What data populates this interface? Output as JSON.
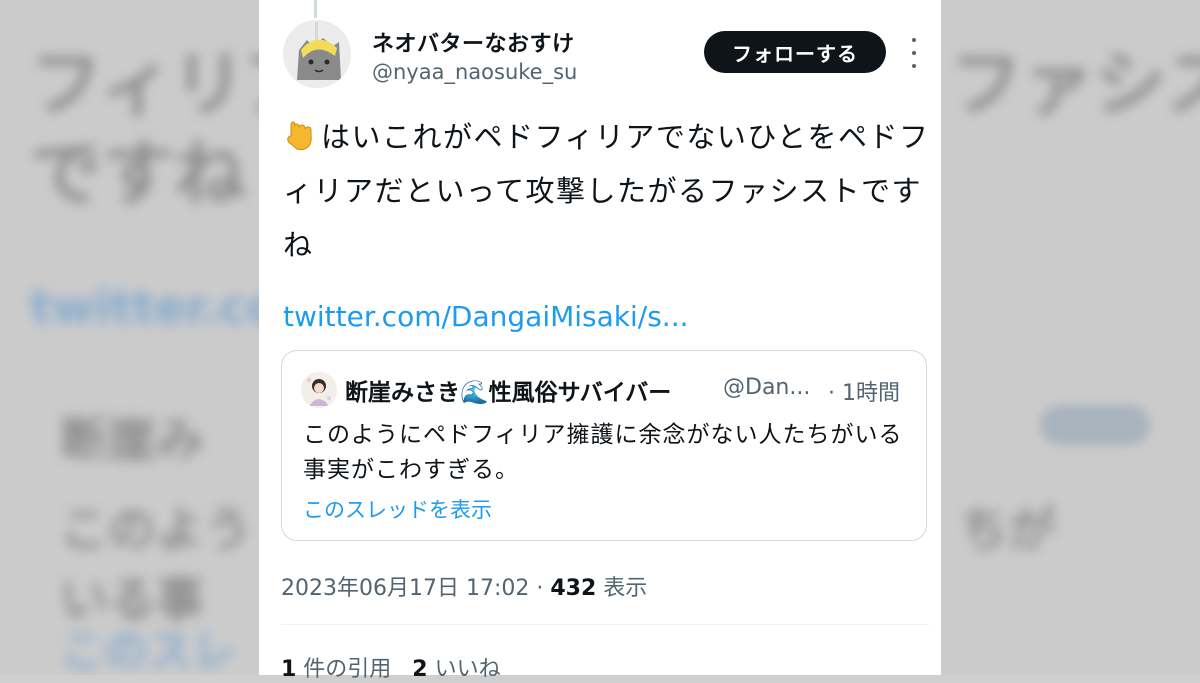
{
  "background": {
    "line1": "フィリア",
    "line2": "ですね",
    "link": "twitter.com",
    "quote_line1": "断崖み",
    "quote_line2": "このよう",
    "quote_line3": "いる事",
    "quote_line4": "このスレ",
    "right_line1": "ファシスト",
    "right_line2": "ちが"
  },
  "author": {
    "display_name": "ネオバターなおすけ",
    "handle": "@nyaa_naosuke_su",
    "avatar_icon": "cat-avatar-icon"
  },
  "follow_label": "フォローする",
  "tweet": {
    "emoji_icon": "pointing-down-finger-icon",
    "text": "はいこれがペドフィリアでないひとをペドフィリアだといって攻撃したがるファシストですね",
    "link_text": "twitter.com/DangaiMisaki/s..."
  },
  "quoted_tweet": {
    "display_name": "断崖みさき🌊性風俗サバイバー",
    "handle": "@Dan...",
    "time": "· 1時間",
    "text": "このようにペドフィリア擁護に余念がない人たちがいる事実がこわすぎる。",
    "thread_link": "このスレッドを表示"
  },
  "meta": {
    "timestamp": "2023年06月17日 17:02 · ",
    "views_count": "432",
    "views_label": " 表示"
  },
  "stats": {
    "quotes_count": "1",
    "quotes_label": " 件の引用",
    "likes_count": "2",
    "likes_label": " いいね"
  },
  "colors": {
    "link": "#1d9bf0",
    "text": "#0f1419",
    "secondary": "#536471",
    "follow_button": "#0f1419"
  }
}
